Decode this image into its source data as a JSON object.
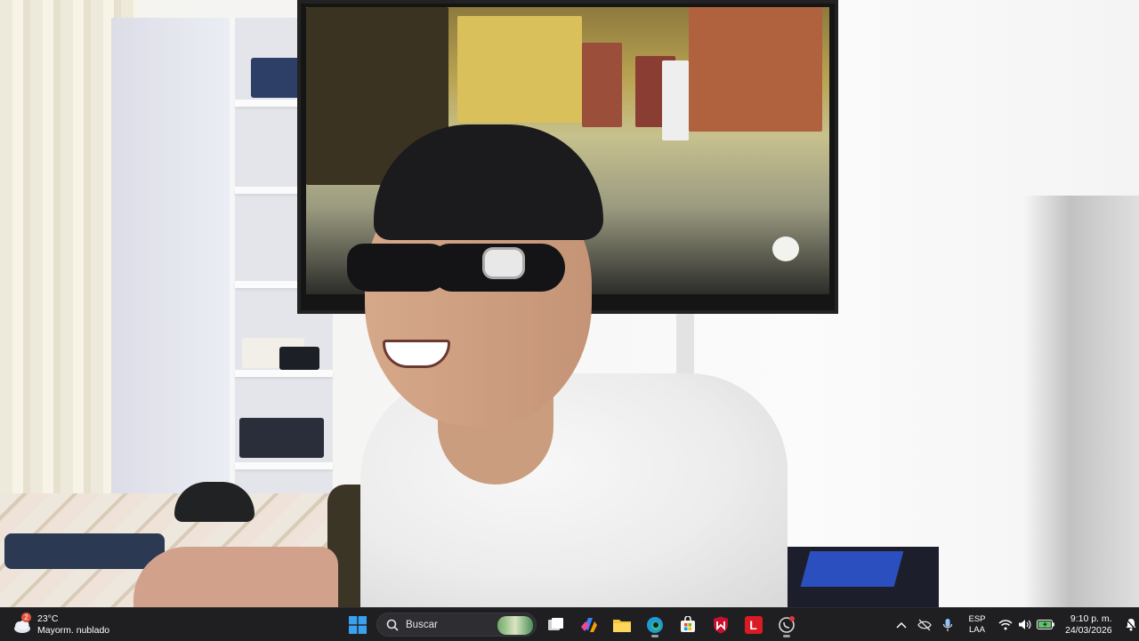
{
  "weather": {
    "temperature": "23°C",
    "condition": "Mayorm. nublado",
    "badge": "2"
  },
  "taskbar": {
    "search_label": "Buscar",
    "apps": [
      {
        "name": "start"
      },
      {
        "name": "search"
      },
      {
        "name": "widgets"
      },
      {
        "name": "task-view"
      },
      {
        "name": "copilot"
      },
      {
        "name": "file-explorer"
      },
      {
        "name": "edge"
      },
      {
        "name": "microsoft-store"
      },
      {
        "name": "mcafee"
      },
      {
        "name": "l-app"
      },
      {
        "name": "whatsapp"
      }
    ],
    "l_app_letter": "L"
  },
  "tray": {
    "language": "ESP",
    "layout": "LAA",
    "time": "9:10 p. m.",
    "date": "24/03/2026"
  },
  "colors": {
    "taskbar_bg": "#1f1f22",
    "accent_blue": "#0a84ff",
    "mcafee_red": "#c8102e"
  }
}
